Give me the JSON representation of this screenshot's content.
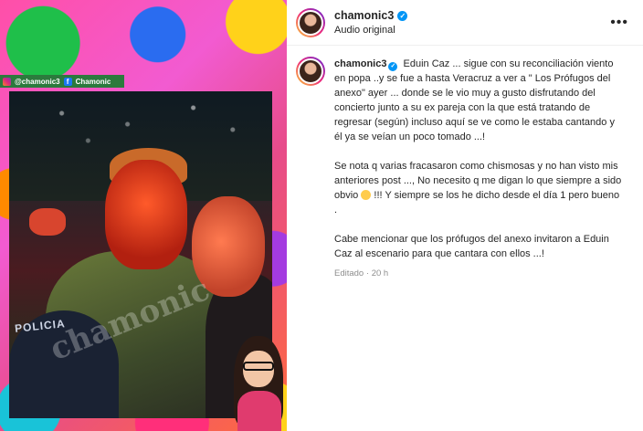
{
  "media": {
    "strip_handle": "@chamonic3",
    "strip_fb": "Chamonic",
    "cap_text": "POLICIA",
    "watermark": "chamonic"
  },
  "header": {
    "username": "chamonic3",
    "subtitle": "Audio original",
    "more_icon": "more-options-icon"
  },
  "caption": {
    "username": "chamonic3",
    "p1": "Eduin Caz ... sigue con su reconciliación viento en popa ..y se fue a hasta Veracruz a ver a \" Los Prófugos del anexo\" ayer ... donde se le vio muy a gusto disfrutando del concierto junto a su ex pareja con la que está tratando de regresar (según) incluso aquí se ve como le estaba cantando y él ya se veían un poco tomado ...!",
    "p2a": "Se nota q varias fracasaron como chismosas y no han visto mis anteriores post ..., No necesito q me digan lo que siempre a sido obvio",
    "p2b": "!!! Y siempre se los he dicho desde el día 1 pero bueno .",
    "p3": "Cabe mencionar que los prófugos del anexo invitaron a Eduin Caz al escenario para que cantara con ellos ...!",
    "edited": "Editado",
    "separator": "·",
    "time": "20 h"
  },
  "colors": {
    "verified": "#0095f6",
    "meta": "#8e8e8e"
  }
}
